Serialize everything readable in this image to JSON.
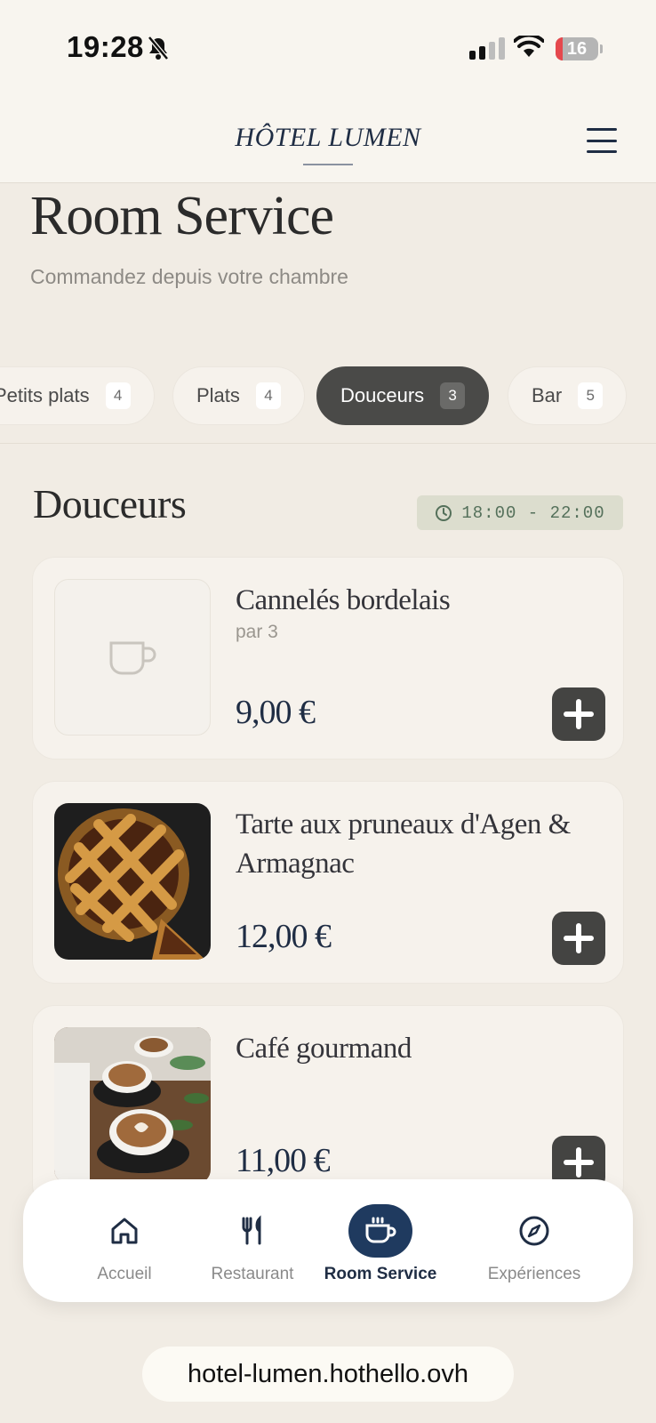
{
  "status_bar": {
    "time": "19:28",
    "battery": "16",
    "battery_level": 0.16
  },
  "header": {
    "logo": "HÔTEL LUMEN"
  },
  "page": {
    "title": "Room Service",
    "subtitle": "Commandez depuis votre chambre"
  },
  "tabs": [
    {
      "label": "Petits plats",
      "count": "4"
    },
    {
      "label": "Plats",
      "count": "4"
    },
    {
      "label": "Douceurs",
      "count": "3",
      "active": true
    },
    {
      "label": "Bar",
      "count": "5"
    }
  ],
  "section": {
    "title": "Douceurs",
    "hours": "18:00 - 22:00"
  },
  "items": [
    {
      "name": "Cannelés bordelais",
      "desc": "par 3",
      "price": "9,00 €",
      "image": "cup-placeholder-icon"
    },
    {
      "name": "Tarte aux pruneaux d'Agen & Armagnac",
      "desc": "",
      "price": "12,00 €",
      "image": "tart-photo"
    },
    {
      "name": "Café gourmand",
      "desc": "",
      "price": "11,00 €",
      "image": "coffee-photo"
    }
  ],
  "bottom_nav": [
    {
      "label": "Accueil",
      "icon": "home-icon"
    },
    {
      "label": "Restaurant",
      "icon": "fork-knife-icon"
    },
    {
      "label": "Room Service",
      "icon": "cup-icon",
      "active": true
    },
    {
      "label": "Expériences",
      "icon": "compass-icon"
    }
  ],
  "browser": {
    "url": "hotel-lumen.hothello.ovh"
  },
  "colors": {
    "navy": "#1f2d44",
    "active_tab": "#4a4a48",
    "background": "#f1ece4",
    "hours_badge": "#dcddce",
    "hours_text": "#54705a"
  }
}
